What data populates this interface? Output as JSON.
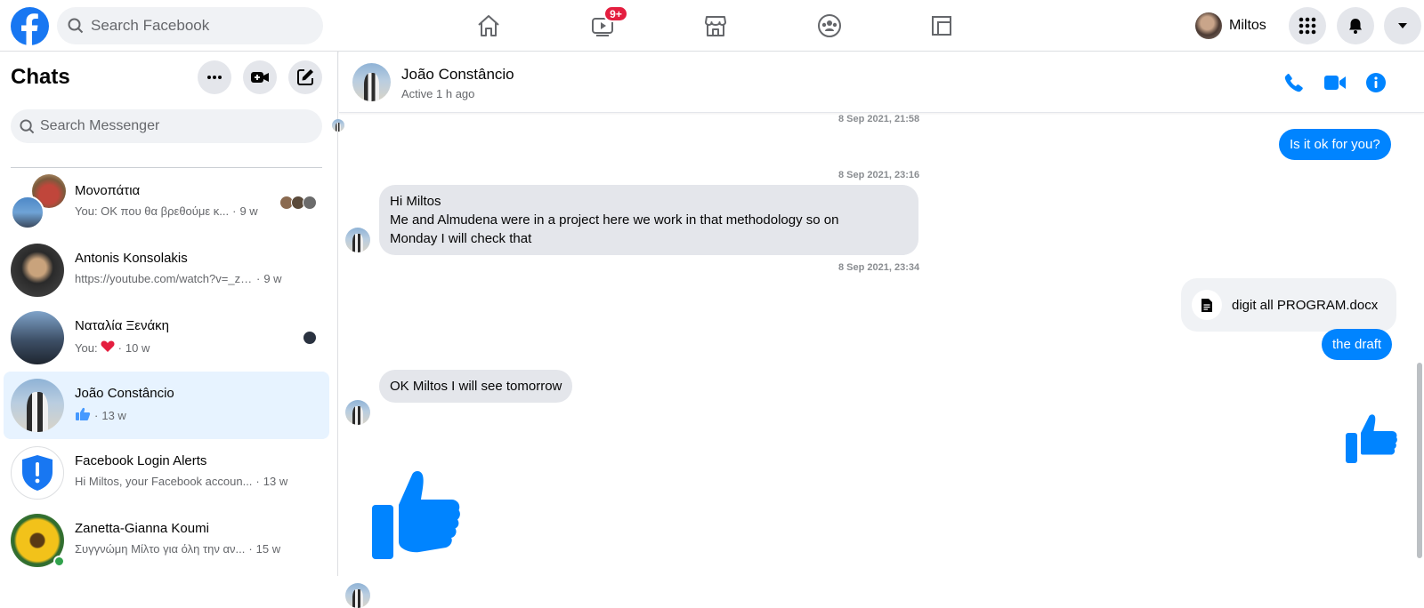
{
  "topbar": {
    "search_placeholder": "Search Facebook",
    "watch_badge": "9+",
    "profile_name": "Miltos"
  },
  "sidebar": {
    "title": "Chats",
    "search_placeholder": "Search Messenger",
    "items": [
      {
        "name": "Μονοπάτια",
        "preview": "You: OK που θα βρεθούμε κ...",
        "time": "9 w"
      },
      {
        "name": "Antonis Konsolakis",
        "preview": "https://youtube.com/watch?v=_zc...",
        "time": "9 w"
      },
      {
        "name": "Ναταλία Ξενάκη",
        "preview": "You: ",
        "time": "10 w"
      },
      {
        "name": "João Constâncio",
        "preview": "",
        "time": "13 w"
      },
      {
        "name": "Facebook Login Alerts",
        "preview": "Hi Miltos, your Facebook accoun...",
        "time": "13 w"
      },
      {
        "name": "Zanetta-Gianna Koumi",
        "preview": "Συγγνώμη Μίλτο για όλη την αν...",
        "time": "15 w"
      }
    ]
  },
  "conversation": {
    "name": "João Constâncio",
    "status": "Active 1 h ago",
    "timestamps": [
      "8 Sep 2021, 21:58",
      "8 Sep 2021, 23:16",
      "8 Sep 2021, 23:34"
    ],
    "messages": {
      "out_1": "Is it ok for you?",
      "in_1_line1": "Hi Miltos",
      "in_1_line2": "Me and Almudena were in a project here we work in that methodology so on",
      "in_1_line3": "Monday I will check that",
      "file_name": "digit all PROGRAM.docx",
      "out_2": "the draft",
      "in_2": "OK Miltos I will see tomorrow"
    }
  },
  "colors": {
    "brand": "#1877f2",
    "messenger_blue": "#0084ff",
    "active_chat_bg": "#e7f3ff",
    "badge_red": "#e41e3f"
  }
}
